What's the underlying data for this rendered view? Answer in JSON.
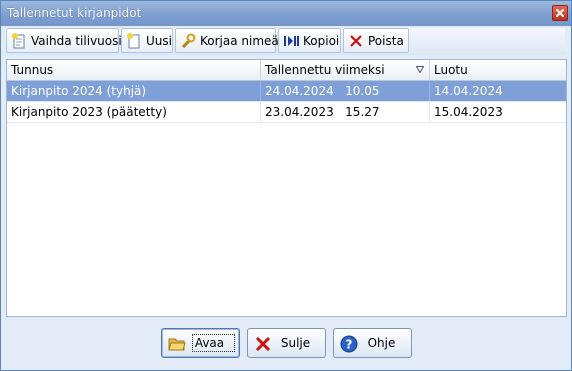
{
  "window": {
    "title": "Tallennetut kirjanpidot"
  },
  "toolbar": {
    "buttons": [
      {
        "label": "Vaihda tilivuosi",
        "icon": "change-year-icon"
      },
      {
        "label": "Uusi",
        "icon": "new-document-icon"
      },
      {
        "label": "Korjaa nimeä",
        "icon": "wrench-icon"
      },
      {
        "label": "Kopioi",
        "icon": "copy-icon"
      },
      {
        "label": "Poista",
        "icon": "delete-icon"
      }
    ]
  },
  "table": {
    "columns": [
      "Tunnus",
      "Tallennettu viimeksi",
      "Luotu"
    ],
    "sorted_column": "Tallennettu viimeksi",
    "rows": [
      {
        "tunnus": "Kirjanpito 2024 (tyhjä)",
        "saved": "24.04.2024   10.05",
        "created": "14.04.2024",
        "selected": true
      },
      {
        "tunnus": "Kirjanpito 2023 (päätetty)",
        "saved": "23.04.2023   15.27",
        "created": "15.04.2023",
        "selected": false
      }
    ]
  },
  "buttons": {
    "open": "Avaa",
    "close": "Sulje",
    "help": "Ohje"
  },
  "colors": {
    "titlebar": "#7e9fd0",
    "selection": "#7f9fd8",
    "window_bg": "#e2ebf6"
  }
}
